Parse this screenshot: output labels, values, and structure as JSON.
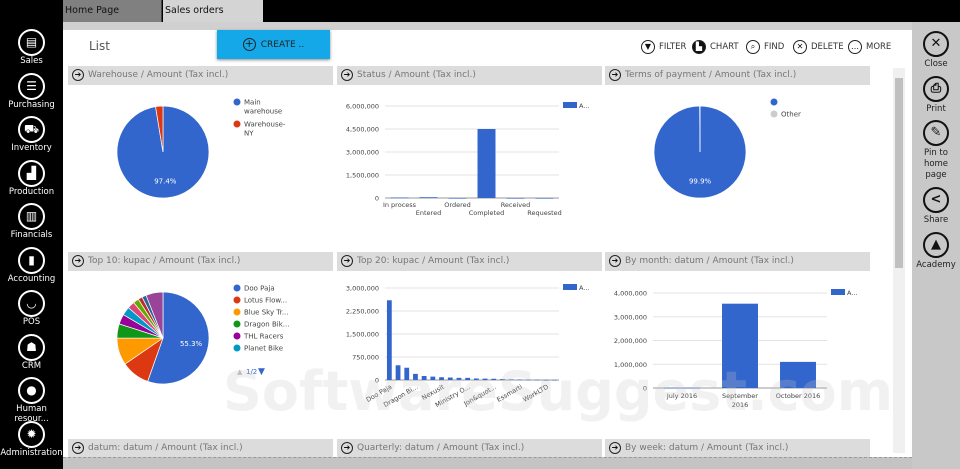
{
  "sidebar": [
    {
      "label": "Sales",
      "icon": "document-icon"
    },
    {
      "label": "Purchasing",
      "icon": "scroll-icon"
    },
    {
      "label": "Inventory",
      "icon": "forklift-icon"
    },
    {
      "label": "Production",
      "icon": "factory-icon"
    },
    {
      "label": "Financials",
      "icon": "books-icon"
    },
    {
      "label": "Accounting",
      "icon": "notebook-icon"
    },
    {
      "label": "POS",
      "icon": "basket-icon"
    },
    {
      "label": "CRM",
      "icon": "people-icon"
    },
    {
      "label": "Human resour...",
      "icon": "person-icon"
    },
    {
      "label": "Administration",
      "icon": "gear-icon"
    }
  ],
  "tabs": [
    {
      "label": "Home Page"
    },
    {
      "label": "Sales orders"
    }
  ],
  "header": {
    "title": "List",
    "create": "CREATE ..",
    "filter": "FILTER",
    "chart": "CHART",
    "find": "FIND",
    "delete": "DELETE",
    "more": "MORE"
  },
  "right": [
    {
      "label": "Close",
      "icon": "close-icon"
    },
    {
      "label": "Print",
      "icon": "print-icon"
    },
    {
      "label": "Pin to home page",
      "icon": "pin-icon"
    },
    {
      "label": "Share",
      "icon": "share-icon"
    },
    {
      "label": "Academy",
      "icon": "academy-icon"
    }
  ],
  "watermark": "SoftwareSuggest.com",
  "colors": {
    "blue": "#3366cc",
    "create": "#14a8e8"
  },
  "chart_data": [
    {
      "type": "pie",
      "title": "Warehouse / Amount (Tax incl.)",
      "labels": [
        "Main warehouse",
        "Warehouse-NY"
      ],
      "values": [
        97.4,
        2.6
      ],
      "colors": [
        "#3366cc",
        "#dc3912"
      ],
      "slice_label": "97.4%"
    },
    {
      "type": "bar",
      "title": "Status / Amount (Tax incl.)",
      "categories": [
        "In process",
        "Entered",
        "Ordered",
        "Completed",
        "Received",
        "Requested"
      ],
      "values": [
        30000,
        50000,
        0,
        4500000,
        0,
        0
      ],
      "ylim": [
        0,
        6000000
      ],
      "yticks": [
        "0",
        "1,500,000",
        "3,000,000",
        "4,500,000",
        "6,000,000"
      ],
      "legend": "A..."
    },
    {
      "type": "pie",
      "title": "Terms of payment / Amount (Tax incl.)",
      "labels": [
        "",
        "Other"
      ],
      "values": [
        99.9,
        0.1
      ],
      "colors": [
        "#3366cc",
        "#cccccc"
      ],
      "slice_label": "99.9%"
    },
    {
      "type": "pie",
      "title": "Top 10: kupac / Amount (Tax incl.)",
      "labels": [
        "Doo Paja",
        "Lotus Flow...",
        "Blue Sky Tr...",
        "Dragon Bik...",
        "THL Racers",
        "Planet Bike"
      ],
      "values": [
        55.3,
        10,
        9.5,
        5,
        3.5,
        3,
        2.5,
        2,
        1.5,
        1.5,
        6
      ],
      "colors": [
        "#3366cc",
        "#dc3912",
        "#ff9900",
        "#109618",
        "#990099",
        "#0099c6",
        "#dd4477",
        "#66aa00",
        "#b82e2e",
        "#316395",
        "#994499"
      ],
      "slice_label": "55.3%",
      "pager": "1/2"
    },
    {
      "type": "bar",
      "title": "Top 20: kupac / Amount (Tax incl.)",
      "categories": [
        "Doo Paja",
        "",
        "",
        "Dragon Bi...",
        "",
        "",
        "Nexusit",
        "",
        "",
        "Ministry O...",
        "",
        "",
        "Jon&quot...",
        "",
        "",
        "Essmarti",
        "",
        "",
        "WorkLTD",
        ""
      ],
      "values": [
        2600000,
        480000,
        400000,
        200000,
        130000,
        110000,
        90000,
        80000,
        70000,
        70000,
        50000,
        45000,
        40000,
        30000,
        20000,
        15000,
        10000,
        8000,
        5000,
        3000
      ],
      "ylim": [
        0,
        3000000
      ],
      "yticks": [
        "0",
        "750,000",
        "1,500,000",
        "2,250,000",
        "3,000,000"
      ],
      "legend": "A..."
    },
    {
      "type": "bar",
      "title": "By month: datum / Amount (Tax incl.)",
      "categories": [
        "July 2016",
        "September 2016",
        "October 2016"
      ],
      "values": [
        10000,
        3550000,
        1100000
      ],
      "ylim": [
        0,
        4000000
      ],
      "yticks": [
        "0",
        "1,000,000",
        "2,000,000",
        "3,000,000",
        "4,000,000"
      ],
      "legend": "A..."
    },
    {
      "type": "bar",
      "title": "datum: datum / Amount (Tax incl.)"
    },
    {
      "type": "bar",
      "title": "Quarterly: datum / Amount (Tax incl.)"
    },
    {
      "type": "bar",
      "title": "By week: datum / Amount (Tax incl.)"
    }
  ]
}
